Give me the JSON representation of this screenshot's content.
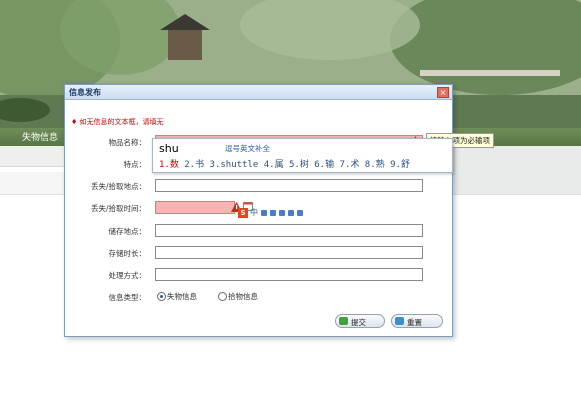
{
  "nav": {
    "item": "失物信息"
  },
  "dialog": {
    "title": "信息发布",
    "close": "×",
    "notice": "♦ 如无信息的文本框，请填无",
    "fields": [
      {
        "label": "物品名称：",
        "value": ""
      },
      {
        "label": "特点：",
        "value": ""
      },
      {
        "label": "丢失/拾取地点：",
        "value": ""
      },
      {
        "label": "丢失/拾取时间：",
        "value": ""
      },
      {
        "label": "储存地点：",
        "value": ""
      },
      {
        "label": "存储时长：",
        "value": ""
      },
      {
        "label": "处理方式：",
        "value": ""
      },
      {
        "label": "信息类型：",
        "value": ""
      }
    ],
    "required_tip": "请输入项为必输项",
    "radio_options": [
      "失物信息",
      "拾物信息"
    ],
    "selected_radio": "失物信息",
    "buttons": {
      "submit": "提交",
      "reset": "重置"
    }
  },
  "ime": {
    "input": "shu",
    "hint": "逗号英文补全",
    "candidates": [
      "1.数",
      "2.书",
      "3.shuttle",
      "4.属",
      "5.树",
      "6.输",
      "7.术",
      "8.熟",
      "9.舒"
    ],
    "toolbar_s": "S",
    "toolbar_zh": "中"
  },
  "colors": {
    "accent": "#cc0000",
    "pink_field": "#f5b5b5",
    "nav_green": "#587645"
  }
}
